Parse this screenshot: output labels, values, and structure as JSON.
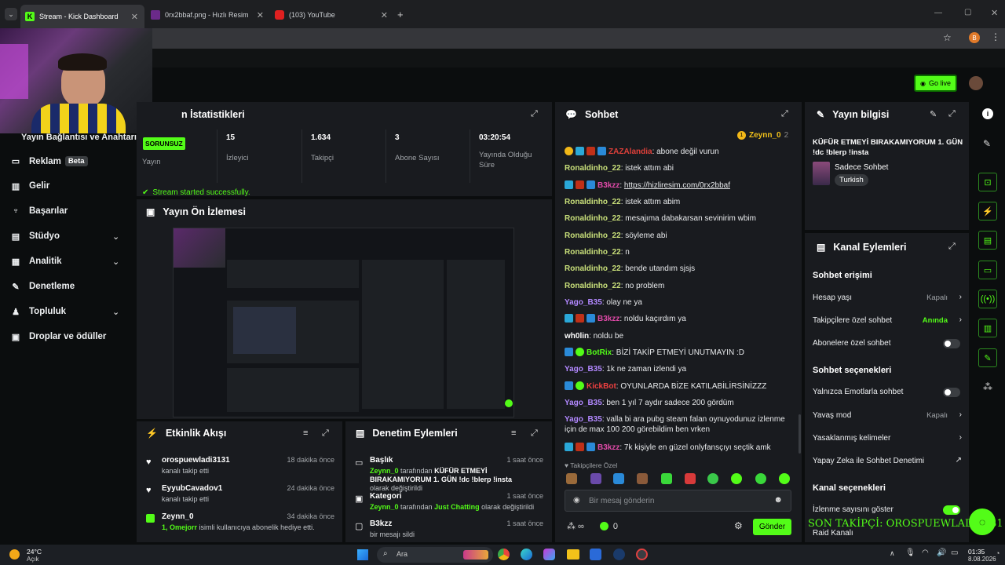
{
  "browser": {
    "tabs": [
      {
        "label": "Stream - Kick Dashboard",
        "active": true
      },
      {
        "label": "0rx2bbaf.png - Hızlı Resim",
        "active": false
      },
      {
        "label": "(103) YouTube",
        "active": false
      }
    ],
    "profile_initial": "B"
  },
  "header": {
    "go_live": "Go live"
  },
  "sidebar": {
    "connection_title": "Yayın Bağlantısı ve Anahtarı",
    "items": [
      {
        "label": "Reklam",
        "badge": "Beta"
      },
      {
        "label": "Gelir"
      },
      {
        "label": "Başarılar"
      },
      {
        "label": "Stüdyo"
      },
      {
        "label": "Analitik"
      },
      {
        "label": "Denetleme"
      },
      {
        "label": "Topluluk"
      },
      {
        "label": "Droplar ve ödüller"
      }
    ]
  },
  "stats": {
    "title": "Yayın İstatistikleri",
    "title_visible": "n İstatistikleri",
    "status_badge": "SORUNSUZ",
    "status_label": "Yayın",
    "viewers_value": "15",
    "viewers_label": "İzleyici",
    "followers_value": "1.634",
    "followers_label": "Takipçi",
    "subs_value": "3",
    "subs_label": "Abone Sayısı",
    "uptime_value": "03:20:54",
    "uptime_label": "Yayında Olduğu Süre",
    "success_msg": "Stream started successfully."
  },
  "preview": {
    "title": "Yayın Ön İzlemesi"
  },
  "activity": {
    "title": "Etkinlik Akışı",
    "events": [
      {
        "name": "orospuewladi3131",
        "sub": "kanalı takip etti",
        "time": "18 dakika önce"
      },
      {
        "name": "EyyubCavadov1",
        "sub": "kanalı takip etti",
        "time": "24 dakika önce"
      },
      {
        "name": "Zeynn_0",
        "sub_prefix": "1, Omejorr",
        "sub": " isimli kullanıcıya abonelik hediye etti.",
        "time": "34 dakika önce"
      }
    ]
  },
  "moderation": {
    "title": "Denetim Eylemleri",
    "items": [
      {
        "title": "Başlık",
        "user": "Zeynn_0",
        "mid": " tarafından ",
        "value": "KÜFÜR ETMEYİ BIRAKAMIYORUM 1. GÜN !dc !blerp !insta",
        "end": " olarak değiştirildi",
        "time": "1 saat önce"
      },
      {
        "title": "Kategori",
        "user": "Zeynn_0",
        "mid": " tarafından ",
        "value": "Just Chatting",
        "end": " olarak değiştirildi",
        "time": "1 saat önce"
      },
      {
        "title": "B3kzz",
        "sub": "bir mesajı sildi",
        "time": "1 saat önce"
      }
    ]
  },
  "chat": {
    "title": "Sohbet",
    "pinned_user": "Zeynn_0",
    "pinned_count": "2",
    "messages": [
      {
        "user": "ZAZAlandia",
        "text": ": abone değil vurun"
      },
      {
        "user": "Ronaldinho_22",
        "text": ": istek attım abi"
      },
      {
        "user": "B3kzz",
        "text": ": ",
        "link": "https://hizliresim.com/0rx2bbaf"
      },
      {
        "user": "Ronaldinho_22",
        "text": ": istek attım abim"
      },
      {
        "user": "Ronaldinho_22",
        "text": ": mesajıma dabakarsan sevinirim wbim"
      },
      {
        "user": "Ronaldinho_22",
        "text": ": söyleme abi"
      },
      {
        "user": "Ronaldinho_22",
        "text": ": n"
      },
      {
        "user": "Ronaldinho_22",
        "text": ": bende utandım sjsjs"
      },
      {
        "user": "Ronaldinho_22",
        "text": ": no problem"
      },
      {
        "user": "Yago_B35",
        "text": ": olay ne ya"
      },
      {
        "user": "B3kzz",
        "text": ": noldu kaçırdım ya"
      },
      {
        "user": "wh0lin",
        "text": ": noldu be"
      },
      {
        "user": "BotRix",
        "text": ": BİZİ TAKİP ETMEYİ UNUTMAYIN :D"
      },
      {
        "user": "Yago_B35",
        "text": ": 1k ne zaman izlendi ya"
      },
      {
        "user": "KickBot",
        "text": ": OYUNLARDA BİZE KATILABİLİRSİNİZZZ"
      },
      {
        "user": "Yago_B35",
        "text": ": ben 1 yıl 7 aydır sadece 200 gördüm"
      },
      {
        "user": "Yago_B35",
        "text": ": valla bi ara pubg steam falan oynuyodunuz izlenme için de max 100 200 görebildim ben vrken"
      },
      {
        "user": "B3kzz",
        "text": ": 7k kişiyle en güzel onlyfansçıyı seçtik amk"
      }
    ],
    "followers_only": "Takipçilere Özel",
    "input_placeholder": "Bir mesaj gönderin",
    "infinity": "∞",
    "points": "0",
    "send": "Gönder"
  },
  "stream_info": {
    "title": "Yayın bilgisi",
    "stream_title": "KÜFÜR ETMEYİ BIRAKAMIYORUM 1. GÜN !dc !blerp !insta",
    "category": "Sadece Sohbet",
    "language": "Turkish"
  },
  "channel_actions": {
    "title": "Kanal Eylemleri",
    "chat_access": "Sohbet erişimi",
    "account_age": "Hesap yaşı",
    "account_age_val": "Kapalı",
    "followers_chat": "Takipçilere özel sohbet",
    "followers_chat_val": "Anında",
    "subs_chat": "Abonelere özel sohbet",
    "chat_options": "Sohbet seçenekleri",
    "emote_only": "Yalnızca Emotlarla sohbet",
    "slow_mode": "Yavaş mod",
    "slow_mode_val": "Kapalı",
    "banned_words": "Yasaklanmış kelimeler",
    "ai_mod": "Yapay Zeka ile Sohbet Denetimi",
    "channel_options": "Kanal seçenekleri",
    "show_viewers": "İzlenme sayısını göster",
    "raid": "Raid Kanalı"
  },
  "overlay": {
    "last_follower": "SON TAKİPÇİ: OROSPUEWLADI3131"
  },
  "taskbar": {
    "weather_temp": "24°C",
    "weather_desc": "Açık",
    "search": "Ara",
    "time": "01:35",
    "date": "8.08.2026"
  },
  "colors": {
    "accent": "#53fc18",
    "panel": "#191b1f",
    "bg": "#0b0d0e"
  }
}
